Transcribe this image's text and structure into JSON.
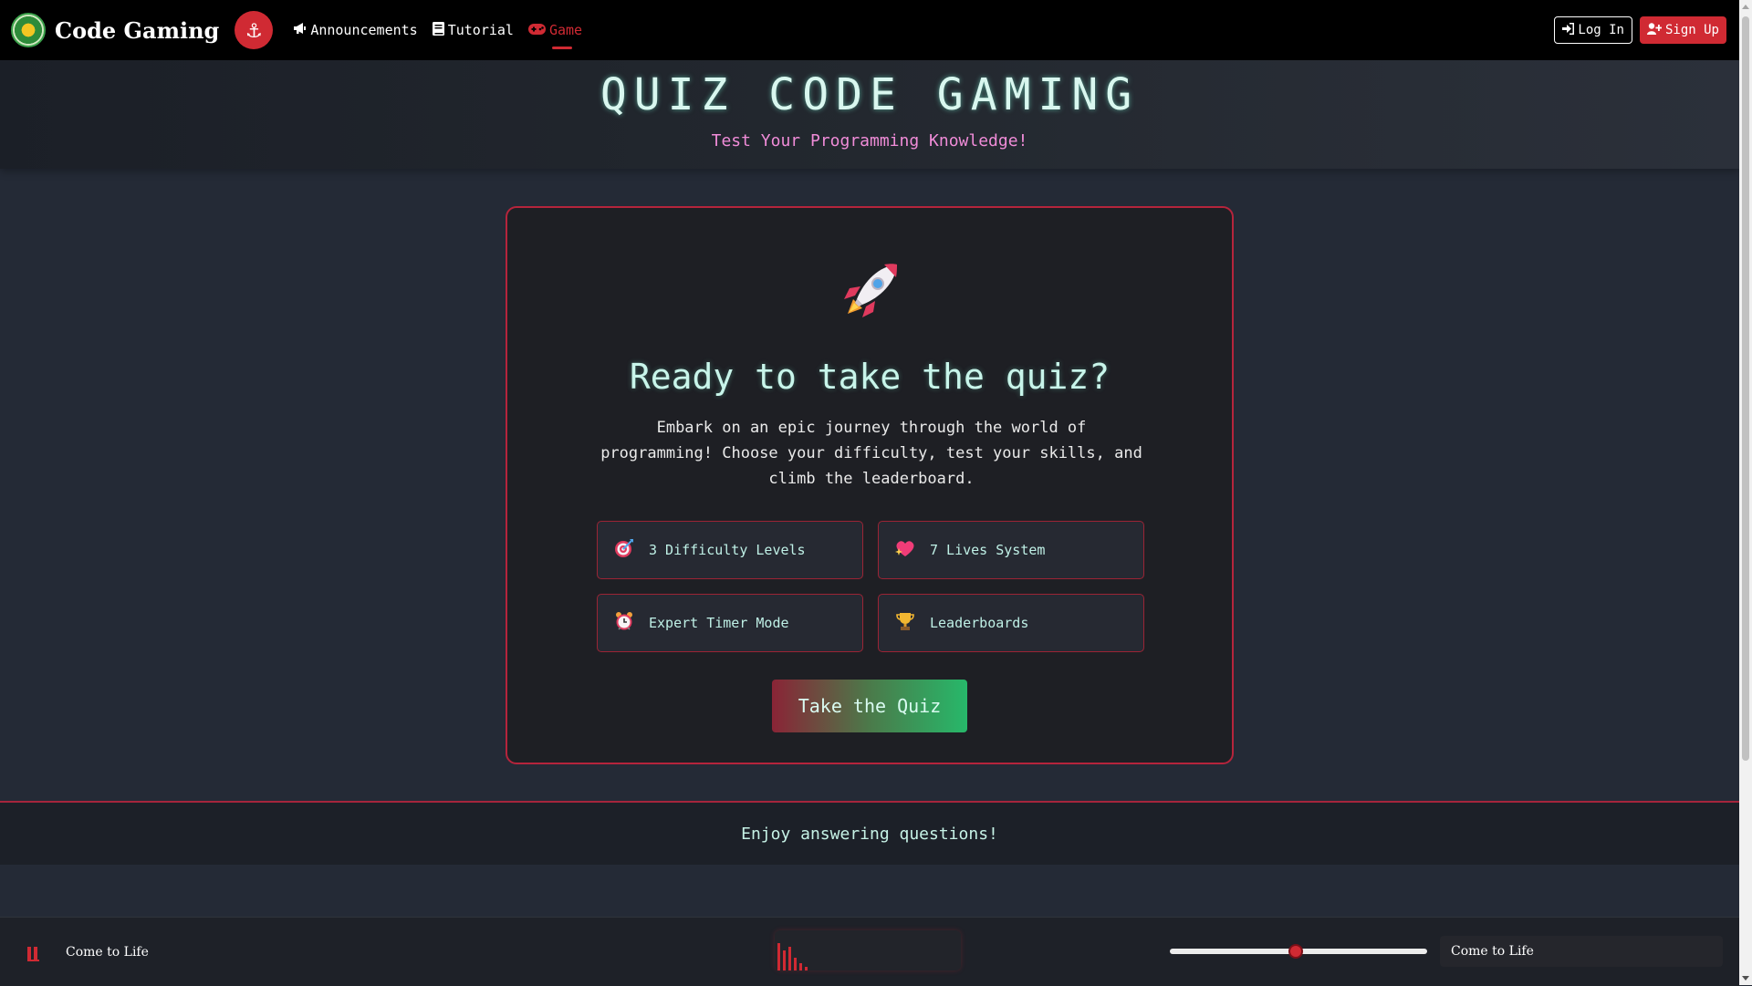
{
  "nav": {
    "brand_title": "Code Gaming",
    "anchor_icon": "anchor-icon",
    "links": [
      {
        "label": "Announcements",
        "icon": "megaphone-icon"
      },
      {
        "label": "Tutorial",
        "icon": "book-icon"
      },
      {
        "label": "Game",
        "icon": "gamepad-icon",
        "active": true
      }
    ],
    "login_label": "Log In",
    "signup_label": "Sign Up"
  },
  "header": {
    "title": "QUIZ CODE GAMING",
    "subtitle": "Test Your Programming Knowledge!"
  },
  "card": {
    "icon": "rocket-icon",
    "title": "Ready to take the quiz?",
    "description": "Embark on an epic journey through the world of programming! Choose your difficulty, test your skills, and climb the leaderboard.",
    "features": [
      {
        "label": "3 Difficulty Levels",
        "icon": "target-icon"
      },
      {
        "label": "7 Lives System",
        "icon": "sparkling-heart-icon"
      },
      {
        "label": "Expert Timer Mode",
        "icon": "alarm-clock-icon"
      },
      {
        "label": "Leaderboards",
        "icon": "trophy-icon"
      }
    ],
    "button_label": "Take the Quiz"
  },
  "footer": {
    "text": "Enjoy answering questions!"
  },
  "player": {
    "track_left": "Come to Life",
    "track_right": "Come to Life",
    "volume_fraction": 0.49
  },
  "colors": {
    "accent_red": "#d02a33",
    "title_mint": "#d9f7ef",
    "subtitle_pink": "#f08cd8",
    "button_green": "#27b86a"
  }
}
